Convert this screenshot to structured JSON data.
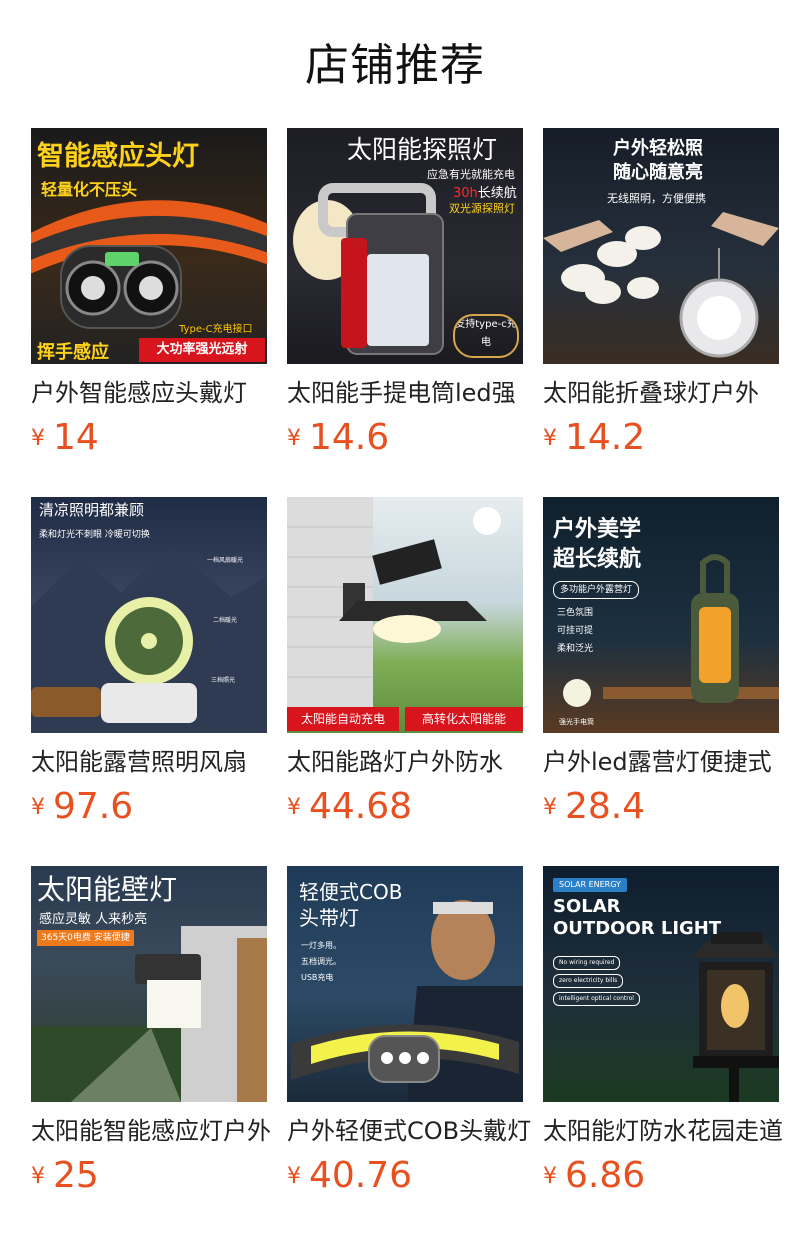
{
  "header": {
    "title": "店铺推荐"
  },
  "currency_symbol": "¥",
  "products": [
    {
      "name": "户外智能感应头戴灯",
      "price": "14",
      "image": {
        "headline": "智能感应头灯",
        "tagline": "轻量化不压头",
        "note": "Type-C充电接口",
        "badge_left": "挥手感应",
        "badge_right": "大功率强光远射"
      }
    },
    {
      "name": "太阳能手提电筒led强",
      "price": "14.6",
      "image": {
        "headline": "太阳能探照灯",
        "line1": "应急有光就能充电",
        "line2": "30h",
        "line2b": "长续航",
        "line3": "双光源探照灯",
        "seal": "支持type-c充电"
      }
    },
    {
      "name": "太阳能折叠球灯户外",
      "price": "14.2",
      "image": {
        "headline1": "户外轻松照",
        "headline2": "随心随意亮",
        "tagline": "无线照明，方便便携"
      }
    },
    {
      "name": "太阳能露营照明风扇",
      "price": "97.6",
      "image": {
        "headline": "清凉照明都兼顾",
        "tagline": "柔和灯光不刺眼 冷暖可切换",
        "label1": "一档风扇暖光",
        "label2": "二档暖光",
        "label3": "三档照光"
      }
    },
    {
      "name": "太阳能路灯户外防水",
      "price": "44.68",
      "image": {
        "badge_left": "太阳能自动充电",
        "badge_right": "高转化太阳能能"
      }
    },
    {
      "name": "户外led露营灯便捷式",
      "price": "28.4",
      "image": {
        "headline1": "户外美学",
        "headline2": "超长续航",
        "tag": "多功能户外露营灯",
        "feat1": "三色氛围",
        "feat2": "可挂可提",
        "feat3": "柔和泛光",
        "note": "强光手电筒"
      }
    },
    {
      "name": "太阳能智能感应灯户外",
      "price": "25",
      "image": {
        "headline": "太阳能壁灯",
        "tagline": "感应灵敏 人来秒亮",
        "tag": "365天0电费 安装便捷"
      }
    },
    {
      "name": "户外轻便式COB头戴灯",
      "price": "40.76",
      "image": {
        "headline1": "轻便式COB",
        "headline2": "头带灯",
        "feat1": "一灯多用。",
        "feat2": "五档调光。",
        "feat3": "USB充电"
      }
    },
    {
      "name": "太阳能灯防水花园走道",
      "price": "6.86",
      "image": {
        "brand": "SOLAR ENERGY",
        "headline1": "SOLAR",
        "headline2": "OUTDOOR LIGHT",
        "pill1": "No wiring required",
        "pill2": "zero electricity bills",
        "pill3": "intelligent optical control"
      }
    }
  ]
}
